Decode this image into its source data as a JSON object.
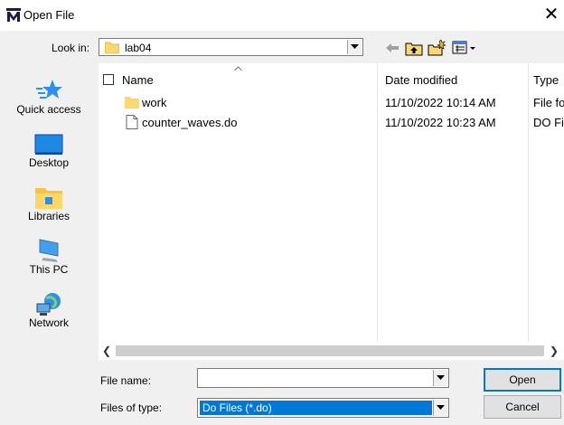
{
  "window": {
    "title": "Open File"
  },
  "lookin": {
    "label": "Look in:",
    "value": "lab04"
  },
  "places": [
    {
      "label": "Quick access",
      "icon": "star-icon"
    },
    {
      "label": "Desktop",
      "icon": "desktop-icon"
    },
    {
      "label": "Libraries",
      "icon": "libraries-icon"
    },
    {
      "label": "This PC",
      "icon": "computer-icon"
    },
    {
      "label": "Network",
      "icon": "network-icon"
    }
  ],
  "columns": [
    "Name",
    "Date modified",
    "Type"
  ],
  "files": [
    {
      "name": "work",
      "date": "11/10/2022 10:14 AM",
      "type": "File fo",
      "icon": "folder-icon"
    },
    {
      "name": "counter_waves.do",
      "date": "11/10/2022 10:23 AM",
      "type": "DO Fi",
      "icon": "file-icon"
    }
  ],
  "form": {
    "filename_label": "File name:",
    "filename_value": "",
    "filetype_label": "Files of type:",
    "filetype_value": "Do Files (*.do)"
  },
  "buttons": {
    "open": "Open",
    "cancel": "Cancel"
  },
  "colors": {
    "accent": "#0078d7",
    "folder": "#f8d775"
  }
}
